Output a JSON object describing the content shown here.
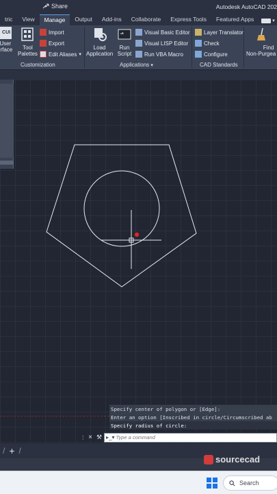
{
  "titlebar": {
    "share_label": "Share",
    "app_title": "Autodesk AutoCAD 202"
  },
  "tabs": [
    {
      "label": "tric",
      "active": false
    },
    {
      "label": "View",
      "active": false
    },
    {
      "label": "Manage",
      "active": true
    },
    {
      "label": "Output",
      "active": false
    },
    {
      "label": "Add-ins",
      "active": false
    },
    {
      "label": "Collaborate",
      "active": false
    },
    {
      "label": "Express Tools",
      "active": false
    },
    {
      "label": "Featured Apps",
      "active": false
    }
  ],
  "ribbon": {
    "customization": {
      "title": "Customization",
      "user_interface": {
        "line1": "User",
        "line2": "erface",
        "badge": "CUI"
      },
      "tool_palettes": {
        "line1": "Tool",
        "line2": "Palettes"
      },
      "import": "Import",
      "export": "Export",
      "edit_aliases": "Edit Aliases"
    },
    "applications": {
      "title": "Applications",
      "load_application": {
        "line1": "Load",
        "line2": "Application"
      },
      "run_script": {
        "line1": "Run",
        "line2": "Script"
      },
      "visual_basic_editor": "Visual Basic Editor",
      "visual_lisp_editor": "Visual LISP Editor",
      "run_vba_macro": "Run VBA Macro"
    },
    "cad_standards": {
      "title": "CAD Standards",
      "layer_translator": "Layer Translator",
      "check": "Check",
      "configure": "Configure"
    },
    "purge": {
      "line1": "Find",
      "line2": "Non-Purgea"
    }
  },
  "command": {
    "history": [
      "Specify center of polygon or [Edge]:",
      "Enter an option [Inscribed in circle/Circumscribed ab",
      "Specify radius of circle:"
    ],
    "input_placeholder": "Type a command"
  },
  "watermark": {
    "text": "sourcecad"
  },
  "taskbar": {
    "search_label": "Search"
  },
  "colors": {
    "ribbon_bg": "#3b4457",
    "canvas_bg": "#212632",
    "accent": "#5aa0e6",
    "snap_marker": "#e02424"
  }
}
